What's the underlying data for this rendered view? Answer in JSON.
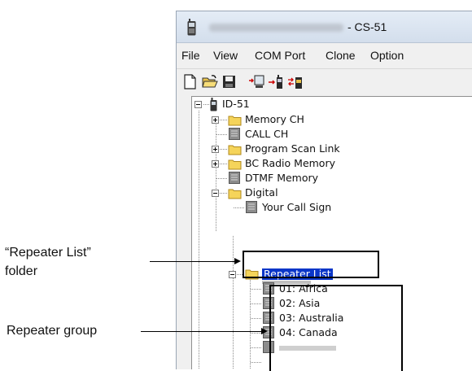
{
  "window": {
    "title_suffix": "- CS-51"
  },
  "menu": {
    "items": [
      {
        "label": "File"
      },
      {
        "label": "View"
      },
      {
        "label": "COM Port"
      },
      {
        "label": "Clone"
      },
      {
        "label": "Option"
      }
    ]
  },
  "toolbar": {
    "buttons": [
      {
        "icon": "new-file-icon"
      },
      {
        "icon": "open-folder-icon"
      },
      {
        "icon": "save-icon"
      },
      {
        "icon": "read-from-radio-icon"
      },
      {
        "icon": "write-to-radio-icon"
      },
      {
        "icon": "clone-transfer-icon"
      }
    ]
  },
  "tree": {
    "root": "ID-51",
    "items": [
      {
        "label": "Memory CH",
        "icon": "folder-icon",
        "expander": "plus"
      },
      {
        "label": "CALL CH",
        "icon": "page-icon"
      },
      {
        "label": "Program Scan Link",
        "icon": "folder-icon",
        "expander": "plus"
      },
      {
        "label": "BC Radio Memory",
        "icon": "folder-icon",
        "expander": "plus"
      },
      {
        "label": "DTMF Memory",
        "icon": "page-icon"
      },
      {
        "label": "Digital",
        "icon": "folder-icon",
        "expander": "minus"
      },
      {
        "label": "Your Call Sign",
        "icon": "page-icon"
      },
      {
        "label": "Repeater List",
        "icon": "folder-icon",
        "expander": "minus",
        "selected": true
      }
    ],
    "groups": [
      {
        "label": "01: Africa"
      },
      {
        "label": "02: Asia"
      },
      {
        "label": "03: Australia"
      },
      {
        "label": "04: Canada"
      }
    ]
  },
  "callouts": {
    "repeater_list_folder": {
      "line1": "“Repeater List”",
      "line2": "folder"
    },
    "repeater_group": "Repeater group"
  },
  "colors": {
    "selection": "#0a36c8",
    "folder": "#f5d45a"
  }
}
